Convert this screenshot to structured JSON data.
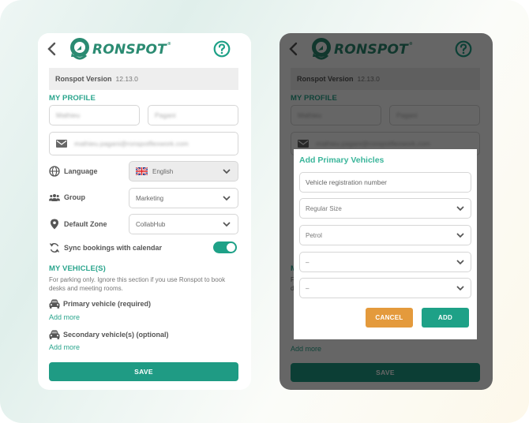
{
  "app": {
    "brand": "RONSPOT",
    "brand_mark": "®",
    "version_label": "Ronspot Version",
    "version_value": "12.13.0"
  },
  "colors": {
    "accent": "#1ea187",
    "accent_text": "#2aa58d",
    "cancel": "#e49a3c"
  },
  "icons": {
    "back": "chevron-left-icon",
    "help": "question-circle-icon",
    "email": "envelope-icon",
    "language": "globe-icon",
    "group": "people-icon",
    "zone": "map-pin-icon",
    "sync": "sync-icon",
    "vehicle": "car-icon",
    "dropdown": "chevron-down-icon",
    "flag": "uk-flag-icon"
  },
  "profile": {
    "section_title": "MY PROFILE",
    "first_name": "Mathieu",
    "last_name": "Pagani",
    "email": "mathieu.pagani@ronspotflexwork.com",
    "language_label": "Language",
    "language_value": "English",
    "group_label": "Group",
    "group_value": "Marketing",
    "zone_label": "Default Zone",
    "zone_value": "CollabHub",
    "sync_label": "Sync bookings with calendar",
    "sync_enabled": true
  },
  "vehicles": {
    "section_title": "MY VEHICLE(S)",
    "note": "For parking only. Ignore this section if you use Ronspot to book desks and meeting rooms.",
    "primary_label": "Primary vehicle (required)",
    "primary_add": "Add more",
    "secondary_label": "Secondary vehicle(s) (optional)",
    "secondary_add": "Add more"
  },
  "save_label": "SAVE",
  "dialog": {
    "title": "Add Primary Vehicles",
    "registration_placeholder": "Vehicle registration number",
    "size_value": "Regular Size",
    "fuel_value": "Petrol",
    "option3_value": "–",
    "option4_value": "–",
    "cancel_label": "CANCEL",
    "add_label": "ADD"
  }
}
